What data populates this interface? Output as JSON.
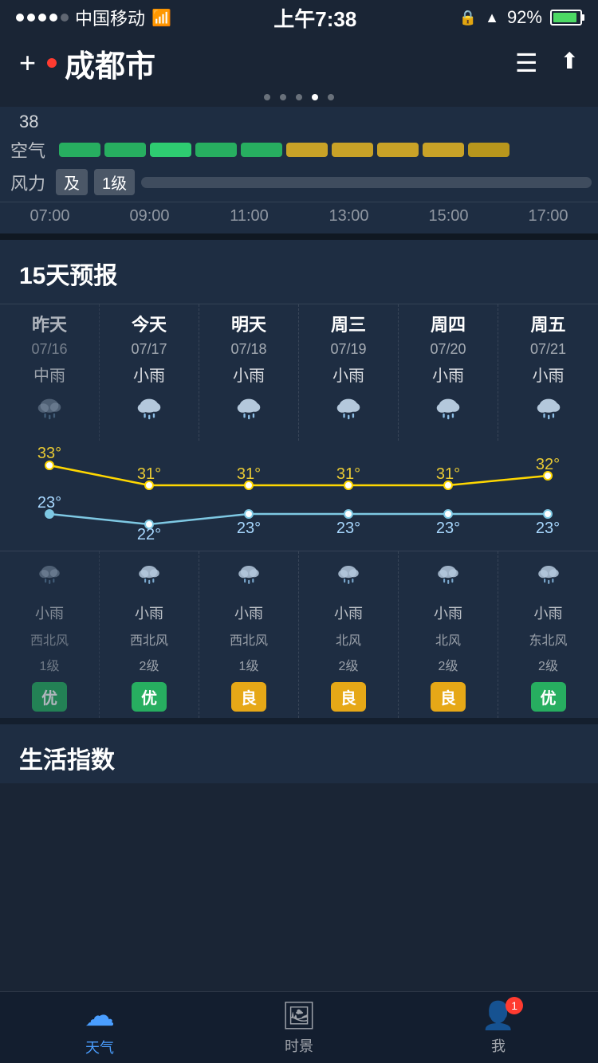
{
  "statusBar": {
    "carrier": "中国移动",
    "time": "上午7:38",
    "battery": "92%",
    "wifiIcon": "📶"
  },
  "header": {
    "city": "成都市",
    "addLabel": "+",
    "listIcon": "☰",
    "shareIcon": "⬆"
  },
  "pageDots": [
    0,
    1,
    2,
    3,
    4
  ],
  "activePageDot": 3,
  "airSection": {
    "airLabel": "空气",
    "windLabel": "风力",
    "windBadge1": "及",
    "windBadge2": "1级",
    "airNumber": "38",
    "timeLabels": [
      "07:00",
      "09:00",
      "11:00",
      "13:00",
      "15:00",
      "17:00"
    ]
  },
  "forecast": {
    "sectionTitle": "15天预报",
    "columns": [
      {
        "day": "昨天",
        "date": "07/16",
        "weatherHigh": "中雨",
        "high": "33°",
        "low": "23°",
        "weatherLow": "小雨",
        "wind": "西北风",
        "windLevel": "1级",
        "badge": "优",
        "badgeType": "green",
        "isYesterday": true
      },
      {
        "day": "今天",
        "date": "07/17",
        "weatherHigh": "小雨",
        "high": "31°",
        "low": "22°",
        "weatherLow": "小雨",
        "wind": "西北风",
        "windLevel": "2级",
        "badge": "优",
        "badgeType": "green",
        "isYesterday": false
      },
      {
        "day": "明天",
        "date": "07/18",
        "weatherHigh": "小雨",
        "high": "31°",
        "low": "23°",
        "weatherLow": "小雨",
        "wind": "西北风",
        "windLevel": "1级",
        "badge": "良",
        "badgeType": "yellow",
        "isYesterday": false
      },
      {
        "day": "周三",
        "date": "07/19",
        "weatherHigh": "小雨",
        "high": "31°",
        "low": "23°",
        "weatherLow": "小雨",
        "wind": "北风",
        "windLevel": "2级",
        "badge": "良",
        "badgeType": "yellow",
        "isYesterday": false
      },
      {
        "day": "周四",
        "date": "07/20",
        "weatherHigh": "小雨",
        "high": "31°",
        "low": "23°",
        "weatherLow": "小雨",
        "wind": "北风",
        "windLevel": "2级",
        "badge": "良",
        "badgeType": "yellow",
        "isYesterday": false
      },
      {
        "day": "周五",
        "date": "07/21",
        "weatherHigh": "小雨",
        "high": "32°",
        "low": "23°",
        "weatherLow": "小雨",
        "wind": "东北风",
        "windLevel": "2级",
        "badge": "优",
        "badgeType": "green",
        "isYesterday": false
      }
    ],
    "highTemps": [
      33,
      31,
      31,
      31,
      31,
      32
    ],
    "lowTemps": [
      23,
      22,
      23,
      23,
      23,
      23
    ]
  },
  "lifeSectionTitle": "生活指数",
  "tabBar": {
    "tabs": [
      {
        "icon": "☁",
        "label": "天气",
        "active": true
      },
      {
        "icon": "🖼",
        "label": "时景",
        "active": false
      },
      {
        "icon": "👤",
        "label": "我",
        "active": false,
        "badge": "1"
      }
    ]
  }
}
